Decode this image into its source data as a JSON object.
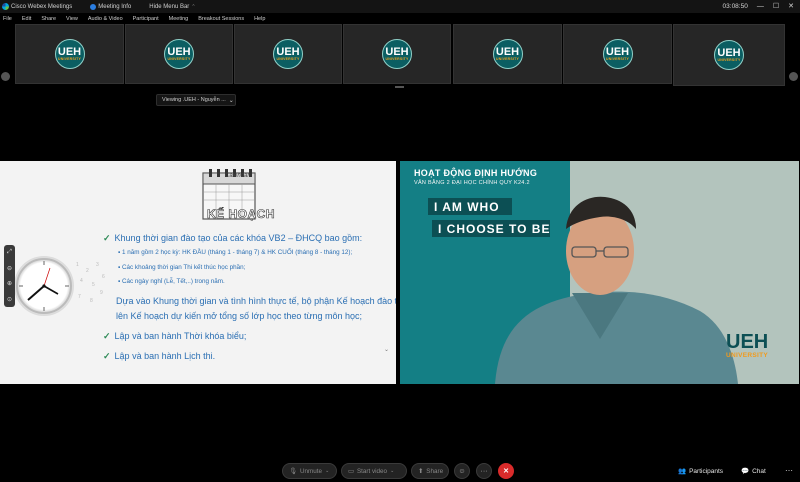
{
  "titlebar": {
    "app_name": "Cisco Webex Meetings",
    "meeting_info": "Meeting Info",
    "hide_menu_bar": "Hide Menu Bar",
    "clock": "03:08:50",
    "minimize": "—",
    "maximize": "☐",
    "close": "✕"
  },
  "menu": [
    "File",
    "Edit",
    "Share",
    "View",
    "Audio & Video",
    "Participant",
    "Meeting",
    "Breakout Sessions",
    "Help"
  ],
  "thumbnails": [
    {
      "logo": "UEH",
      "sub": "UNIVERSITY"
    },
    {
      "logo": "UEH",
      "sub": "UNIVERSITY"
    },
    {
      "logo": "UEH",
      "sub": "UNIVERSITY"
    },
    {
      "logo": "UEH",
      "sub": "UNIVERSITY"
    },
    {
      "logo": "UEH",
      "sub": "UNIVERSITY"
    },
    {
      "logo": "UEH",
      "sub": "UNIVERSITY"
    },
    {
      "logo": "UEH",
      "sub": "UNIVERSITY"
    }
  ],
  "viewing": {
    "label": "Viewing .UEH - Nguyễn ...",
    "chevron": "⌄"
  },
  "slide": {
    "calendar_label": "Calendar",
    "plan_word": "KẾ HOẠCH",
    "line1": "Khung thời gian đào tạo của các khóa VB2 – ĐHCQ bao gồm:",
    "bullet1": "1 năm gồm 2 học kỳ: HK ĐẦU (tháng 1 - tháng 7) & HK CUỐI (tháng 8 - tháng 12);",
    "bullet2": "Các khoảng thời gian Thi kết thúc học phần;",
    "bullet3": "Các ngày nghỉ (Lễ, Tết,..) trong năm.",
    "para1": "Dựa vào Khung thời gian và tình hình thực tế, bộ phận Kế hoạch đào tạo",
    "para2": "lên Kế hoạch dự kiến mở tổng số lớp học theo từng môn học;",
    "check2": "Lập và ban hành Thời khóa biểu;",
    "check3": "Lập và ban hành Lịch thi."
  },
  "video": {
    "title": "HOẠT ĐỘNG ĐỊNH HƯỚNG",
    "subtitle": "VĂN BẰNG 2 ĐẠI HỌC CHÍNH QUY K24.2",
    "banner1": "I AM WHO",
    "banner2": "I CHOOSE TO BE",
    "logo": "UEH",
    "logo_sub": "UNIVERSITY"
  },
  "toolbar": {
    "unmute": "Unmute",
    "start_video": "Start video",
    "share": "Share",
    "participants": "Participants",
    "chat": "Chat",
    "more": "···"
  },
  "colors": {
    "ueh_teal": "#0c4f54",
    "ueh_orange": "#f29a1c",
    "slide_text": "#2b6fb3",
    "end_red": "#d92b2b"
  }
}
